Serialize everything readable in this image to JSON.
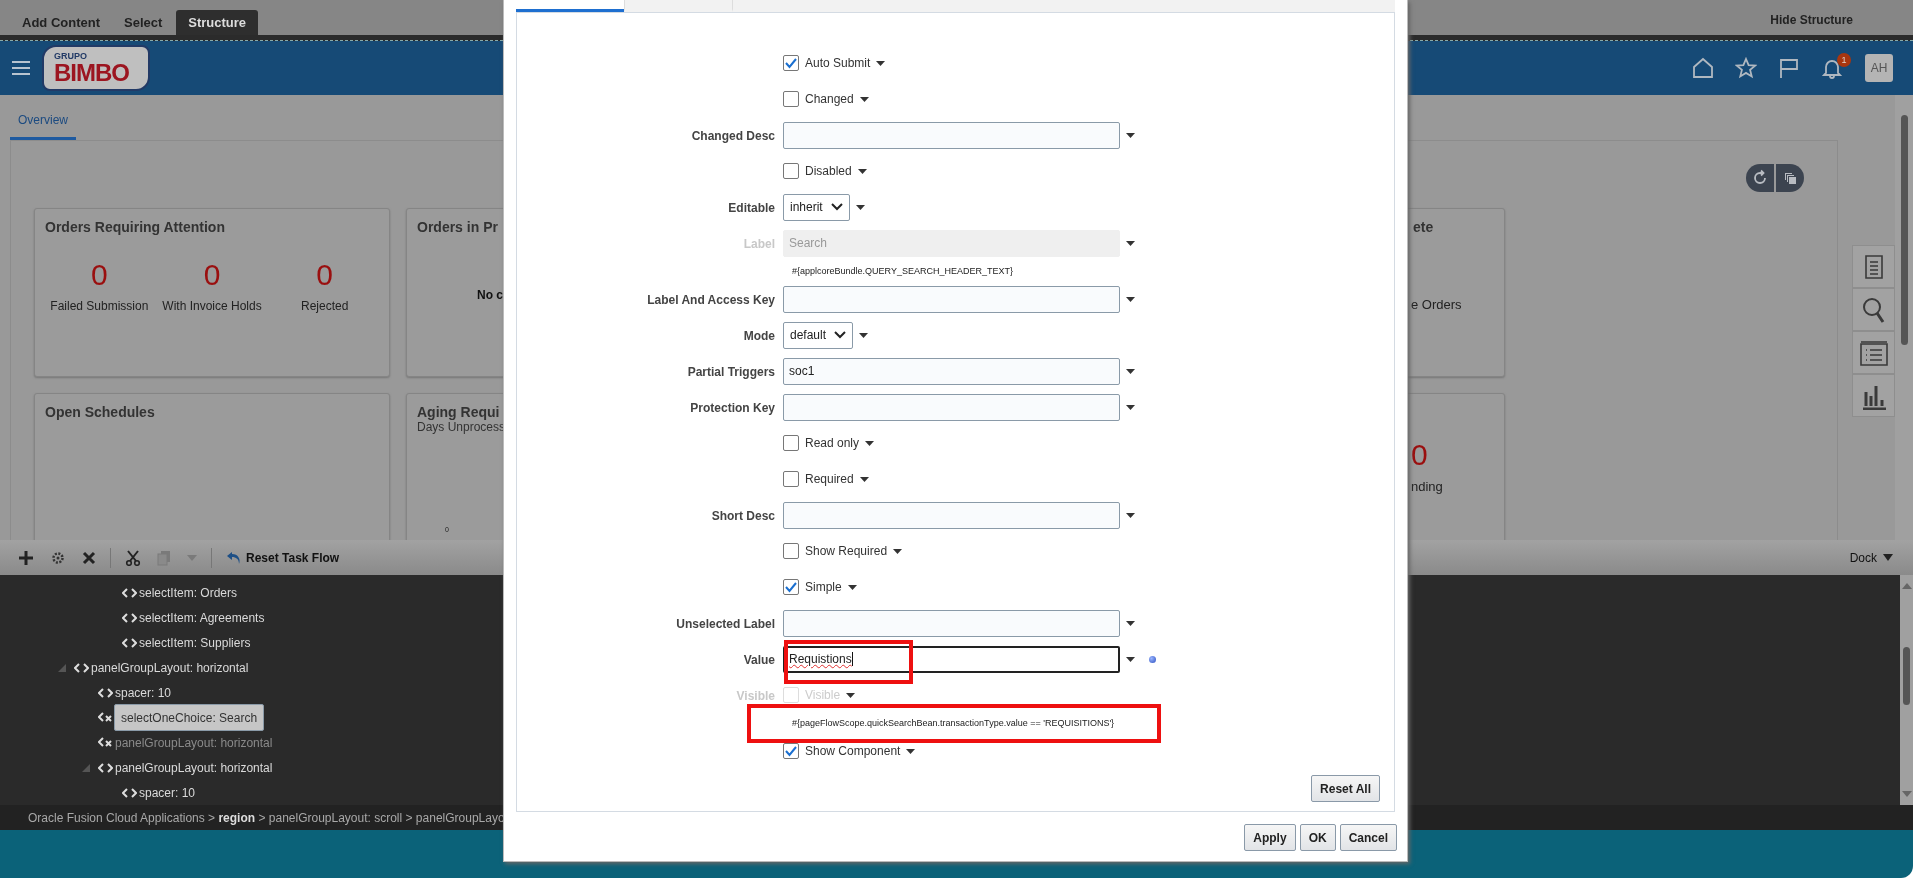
{
  "structure_bar": {
    "tabs": [
      {
        "label": "Add Content",
        "selected": false
      },
      {
        "label": "Select",
        "selected": false
      },
      {
        "label": "Structure",
        "selected": true
      }
    ],
    "hide_button": "Hide Structure"
  },
  "header": {
    "logo_top": "GRUPO",
    "logo_main": "BIMBO",
    "notification_count": "1",
    "avatar": "AH"
  },
  "page_tabs": [
    {
      "label": "Overview",
      "selected": true
    }
  ],
  "card_rows": [
    [
      {
        "title": "Orders Requiring Attention",
        "metrics": [
          {
            "value": "0",
            "label": "Failed Submission"
          },
          {
            "value": "0",
            "label": "With Invoice Holds"
          },
          {
            "value": "0",
            "label": "Rejected"
          }
        ]
      },
      {
        "title": "Orders in Pr",
        "message": "No c"
      },
      {
        "title": "ete",
        "metrics": [
          {
            "label": "e Orders"
          }
        ]
      }
    ],
    [
      {
        "title": "Open Schedules"
      },
      {
        "title": "Aging Requi",
        "subtitle": "Days Unprocess",
        "axis_label": "0"
      },
      {
        "metrics": [
          {
            "value": "0",
            "label": "nding"
          }
        ]
      }
    ]
  ],
  "dev_panel": {
    "toolbar": {
      "reset_label": "Reset Task Flow",
      "dock_label": "Dock"
    },
    "tree": {
      "continued_items": [
        {
          "label": "selectItem: Orders",
          "selected": false,
          "hidden": false
        },
        {
          "label": "selectItem: Agreements",
          "selected": false,
          "hidden": false
        },
        {
          "label": "selectItem: Suppliers",
          "selected": false,
          "hidden": false
        }
      ],
      "items": [
        {
          "label": "panelGroupLayout: horizontal",
          "selected": false,
          "hidden": false,
          "expanded": true,
          "children": [
            {
              "label": "spacer: 10",
              "selected": false,
              "hidden": false
            },
            {
              "label": "selectOneChoice: Search",
              "selected": true,
              "hidden": true
            },
            {
              "label": "panelGroupLayout: horizontal",
              "selected": false,
              "hidden": true
            },
            {
              "label": "panelGroupLayout: horizontal",
              "selected": false,
              "hidden": false,
              "expanded": true,
              "children": [
                {
                  "label": "spacer: 10",
                  "selected": false,
                  "hidden": false
                }
              ]
            }
          ]
        }
      ]
    },
    "breadcrumb": "Oracle Fusion Cloud Applications > **region** > panelGroupLayout: scroll > panelGroupLayo"
  },
  "dialog": {
    "tabs": [
      {
        "selected": true
      },
      {
        "selected": false
      },
      {
        "selected": false
      }
    ],
    "form": [
      {
        "kind": "checkbox",
        "text": "Auto Submit",
        "checked": true
      },
      {
        "kind": "checkbox",
        "text": "Changed",
        "checked": false
      },
      {
        "kind": "text",
        "label": "Changed Desc"
      },
      {
        "kind": "checkbox",
        "text": "Disabled",
        "checked": false
      },
      {
        "kind": "select",
        "label": "Editable",
        "value": "inherit"
      },
      {
        "kind": "text",
        "label": "Label",
        "value": "Search",
        "disabled": true,
        "expression": "#{applcoreBundle.QUERY_SEARCH_HEADER_TEXT}"
      },
      {
        "kind": "text",
        "label": "Label And Access Key"
      },
      {
        "kind": "select",
        "label": "Mode",
        "value": "default"
      },
      {
        "kind": "text",
        "label": "Partial Triggers",
        "value": "soc1"
      },
      {
        "kind": "text",
        "label": "Protection Key"
      },
      {
        "kind": "checkbox",
        "text": "Read only",
        "checked": false
      },
      {
        "kind": "checkbox",
        "text": "Required",
        "checked": false
      },
      {
        "kind": "text",
        "label": "Short Desc"
      },
      {
        "kind": "checkbox",
        "text": "Show Required",
        "checked": false
      },
      {
        "kind": "checkbox",
        "text": "Simple",
        "checked": true
      },
      {
        "kind": "text",
        "label": "Unselected Label"
      },
      {
        "kind": "text",
        "label": "Value",
        "value": "Requistions",
        "focused": true,
        "spelling_error": true,
        "expression_set": true
      },
      {
        "kind": "checkbox",
        "label": "Visible",
        "text": "Visible",
        "checked": false,
        "disabled": true,
        "expression": "#{pageFlowScope.quickSearchBean.transactionType.value == 'REQUISITIONS'}"
      },
      {
        "kind": "checkbox",
        "text": "Show Component",
        "checked": true
      }
    ],
    "reset_button": "Reset All",
    "buttons": [
      "Apply",
      "OK",
      "Cancel"
    ]
  }
}
